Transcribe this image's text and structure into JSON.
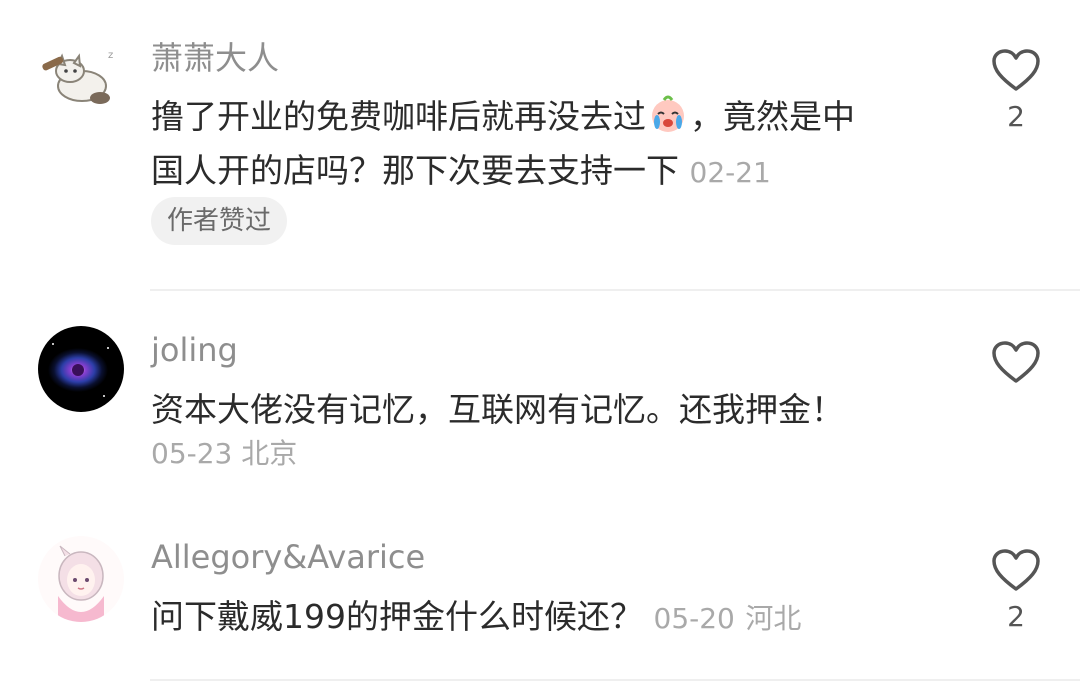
{
  "comments": [
    {
      "username": "萧萧大人",
      "text_line1_a": "撸了开业的免费咖啡后就再没去过",
      "text_line1_b": "，竟然是中",
      "text_line2": "国人开的店吗？那下次要去支持一下",
      "date": "02-21",
      "location": "",
      "badge": "作者赞过",
      "likes": "2",
      "emoji": "crying-face-emoji",
      "avatar": "cat-avatar"
    },
    {
      "username": "joling",
      "text": "资本大佬没有记忆，互联网有记忆。还我押金！",
      "date": "05-23",
      "location": "北京",
      "likes": "",
      "avatar": "nebula-avatar"
    },
    {
      "username": "Allegory&Avarice",
      "text": "问下戴威199的押金什么时候还？",
      "date": "05-20",
      "location": "河北",
      "likes": "2",
      "avatar": "anime-girl-avatar"
    }
  ],
  "colors": {
    "username": "#8e8e8e",
    "text": "#2b2b2b",
    "meta": "#a9a9a9",
    "badge_bg": "#f1f1f1",
    "divider": "#efefef",
    "heart_stroke": "#555555"
  }
}
